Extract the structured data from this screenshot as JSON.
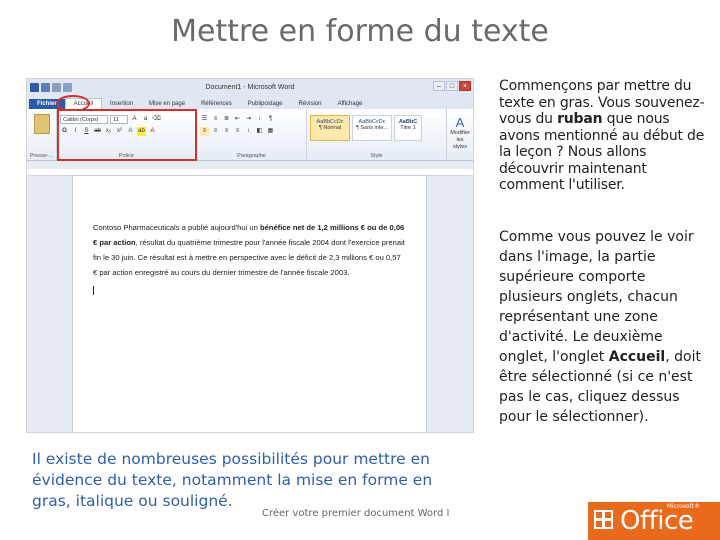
{
  "slide": {
    "title": "Mettre en forme du texte",
    "footer": "Créer votre premier document Word I",
    "caption": "Il existe de nombreuses possibilités pour mettre en évidence du texte, notamment la mise en forme en gras, italique ou souligné."
  },
  "word": {
    "window_title": "Document1 - Microsoft Word",
    "tabs": [
      "Fichier",
      "Accueil",
      "Insertion",
      "Mise en page",
      "Références",
      "Publipostage",
      "Révision",
      "Affichage"
    ],
    "font_name": "Calibri (Corps)",
    "font_size": "11",
    "groups": {
      "clipboard": "Presse-...",
      "font": "Police",
      "paragraph": "Paragraphe",
      "styles": "Style"
    },
    "style_cards": [
      "AaBbCcDc",
      "AaBbCcDc",
      "AaBbC"
    ],
    "style_names": [
      "¶ Normal",
      "¶ Sans inte...",
      "Titre 1"
    ],
    "change_styles": "Modifier les styles",
    "document": {
      "s1": "Contoso Pharmaceuticals a publié aujourd'hui un ",
      "b1": "bénéfice net de 1,2 millions € ou de 0,06 € par action",
      "s2": ", résultat du quatrième trimestre pour l'année fiscale 2004 dont l'exercice prenait fin le 30 juin. Ce résultat est à mettre en perspective avec le déficit de 2,3 millions € ou 0,57 € par action enregistré au cours du dernier trimestre de l'année fiscale 2003."
    }
  },
  "right": {
    "p1_a": "Commençons par mettre du texte en gras. Vous souvenez-vous du ",
    "p1_bold": "ruban",
    "p1_b": " que nous avons mentionné au début de la leçon ? Nous allons découvrir maintenant comment l'utiliser.",
    "p2_a": "Comme vous pouvez le voir dans l'image, la partie supérieure comporte plusieurs onglets, chacun représentant une zone d'activité. Le deuxième onglet, l'onglet ",
    "p2_bold": "Accueil",
    "p2_b": ", doit être sélectionné (si ce n'est pas le cas, cliquez dessus pour le sélectionner)."
  },
  "logo": {
    "text": "Office",
    "ms": "Microsoft®"
  },
  "colors": {
    "accent_red": "#d0312d",
    "caption_blue": "#2e5fa8",
    "office_orange": "#ea6a1c",
    "file_tab": "#2a5aa8"
  }
}
